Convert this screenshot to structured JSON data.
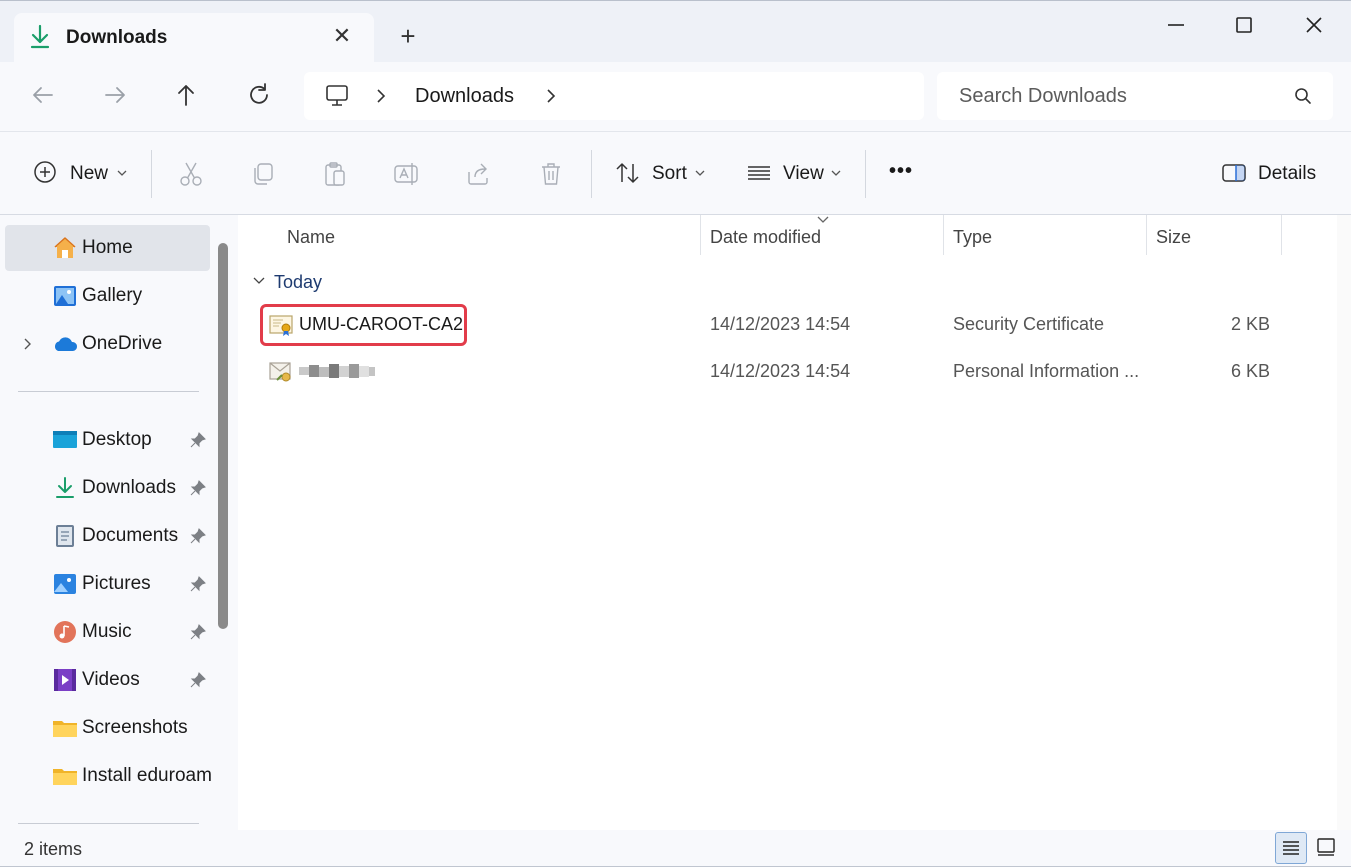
{
  "window": {
    "tab_title": "Downloads",
    "new_tab_symbol": "+",
    "tab_close_symbol": "✕"
  },
  "address": {
    "location": "Downloads"
  },
  "search": {
    "placeholder": "Search Downloads"
  },
  "toolbar": {
    "new_label": "New",
    "sort_label": "Sort",
    "view_label": "View",
    "more_symbol": "•••",
    "details_label": "Details"
  },
  "sidebar": {
    "items": [
      {
        "label": "Home",
        "icon": "home-icon"
      },
      {
        "label": "Gallery",
        "icon": "gallery-icon"
      },
      {
        "label": "OneDrive",
        "icon": "onedrive-icon"
      },
      {
        "label": "Desktop",
        "icon": "desktop-icon"
      },
      {
        "label": "Downloads",
        "icon": "downloads-icon"
      },
      {
        "label": "Documents",
        "icon": "documents-icon"
      },
      {
        "label": "Pictures",
        "icon": "pictures-icon"
      },
      {
        "label": "Music",
        "icon": "music-icon"
      },
      {
        "label": "Videos",
        "icon": "videos-icon"
      },
      {
        "label": "Screenshots",
        "icon": "folder-icon"
      },
      {
        "label": "Install eduroam",
        "icon": "folder-icon"
      }
    ]
  },
  "columns": {
    "name": "Name",
    "date": "Date modified",
    "type": "Type",
    "size": "Size"
  },
  "group": {
    "label": "Today"
  },
  "files": [
    {
      "name": "UMU-CAROOT-CA2",
      "date": "14/12/2023 14:54",
      "type": "Security Certificate",
      "size": "2 KB",
      "icon": "certificate-icon"
    },
    {
      "name": "",
      "date": "14/12/2023 14:54",
      "type": "Personal Information ...",
      "size": "6 KB",
      "icon": "personal-info-icon"
    }
  ],
  "status": {
    "items_count": "2 items"
  },
  "colors": {
    "highlight": "#e23c4a",
    "download_green": "#1a9e6a",
    "accent_blue": "#2b6fd6"
  }
}
